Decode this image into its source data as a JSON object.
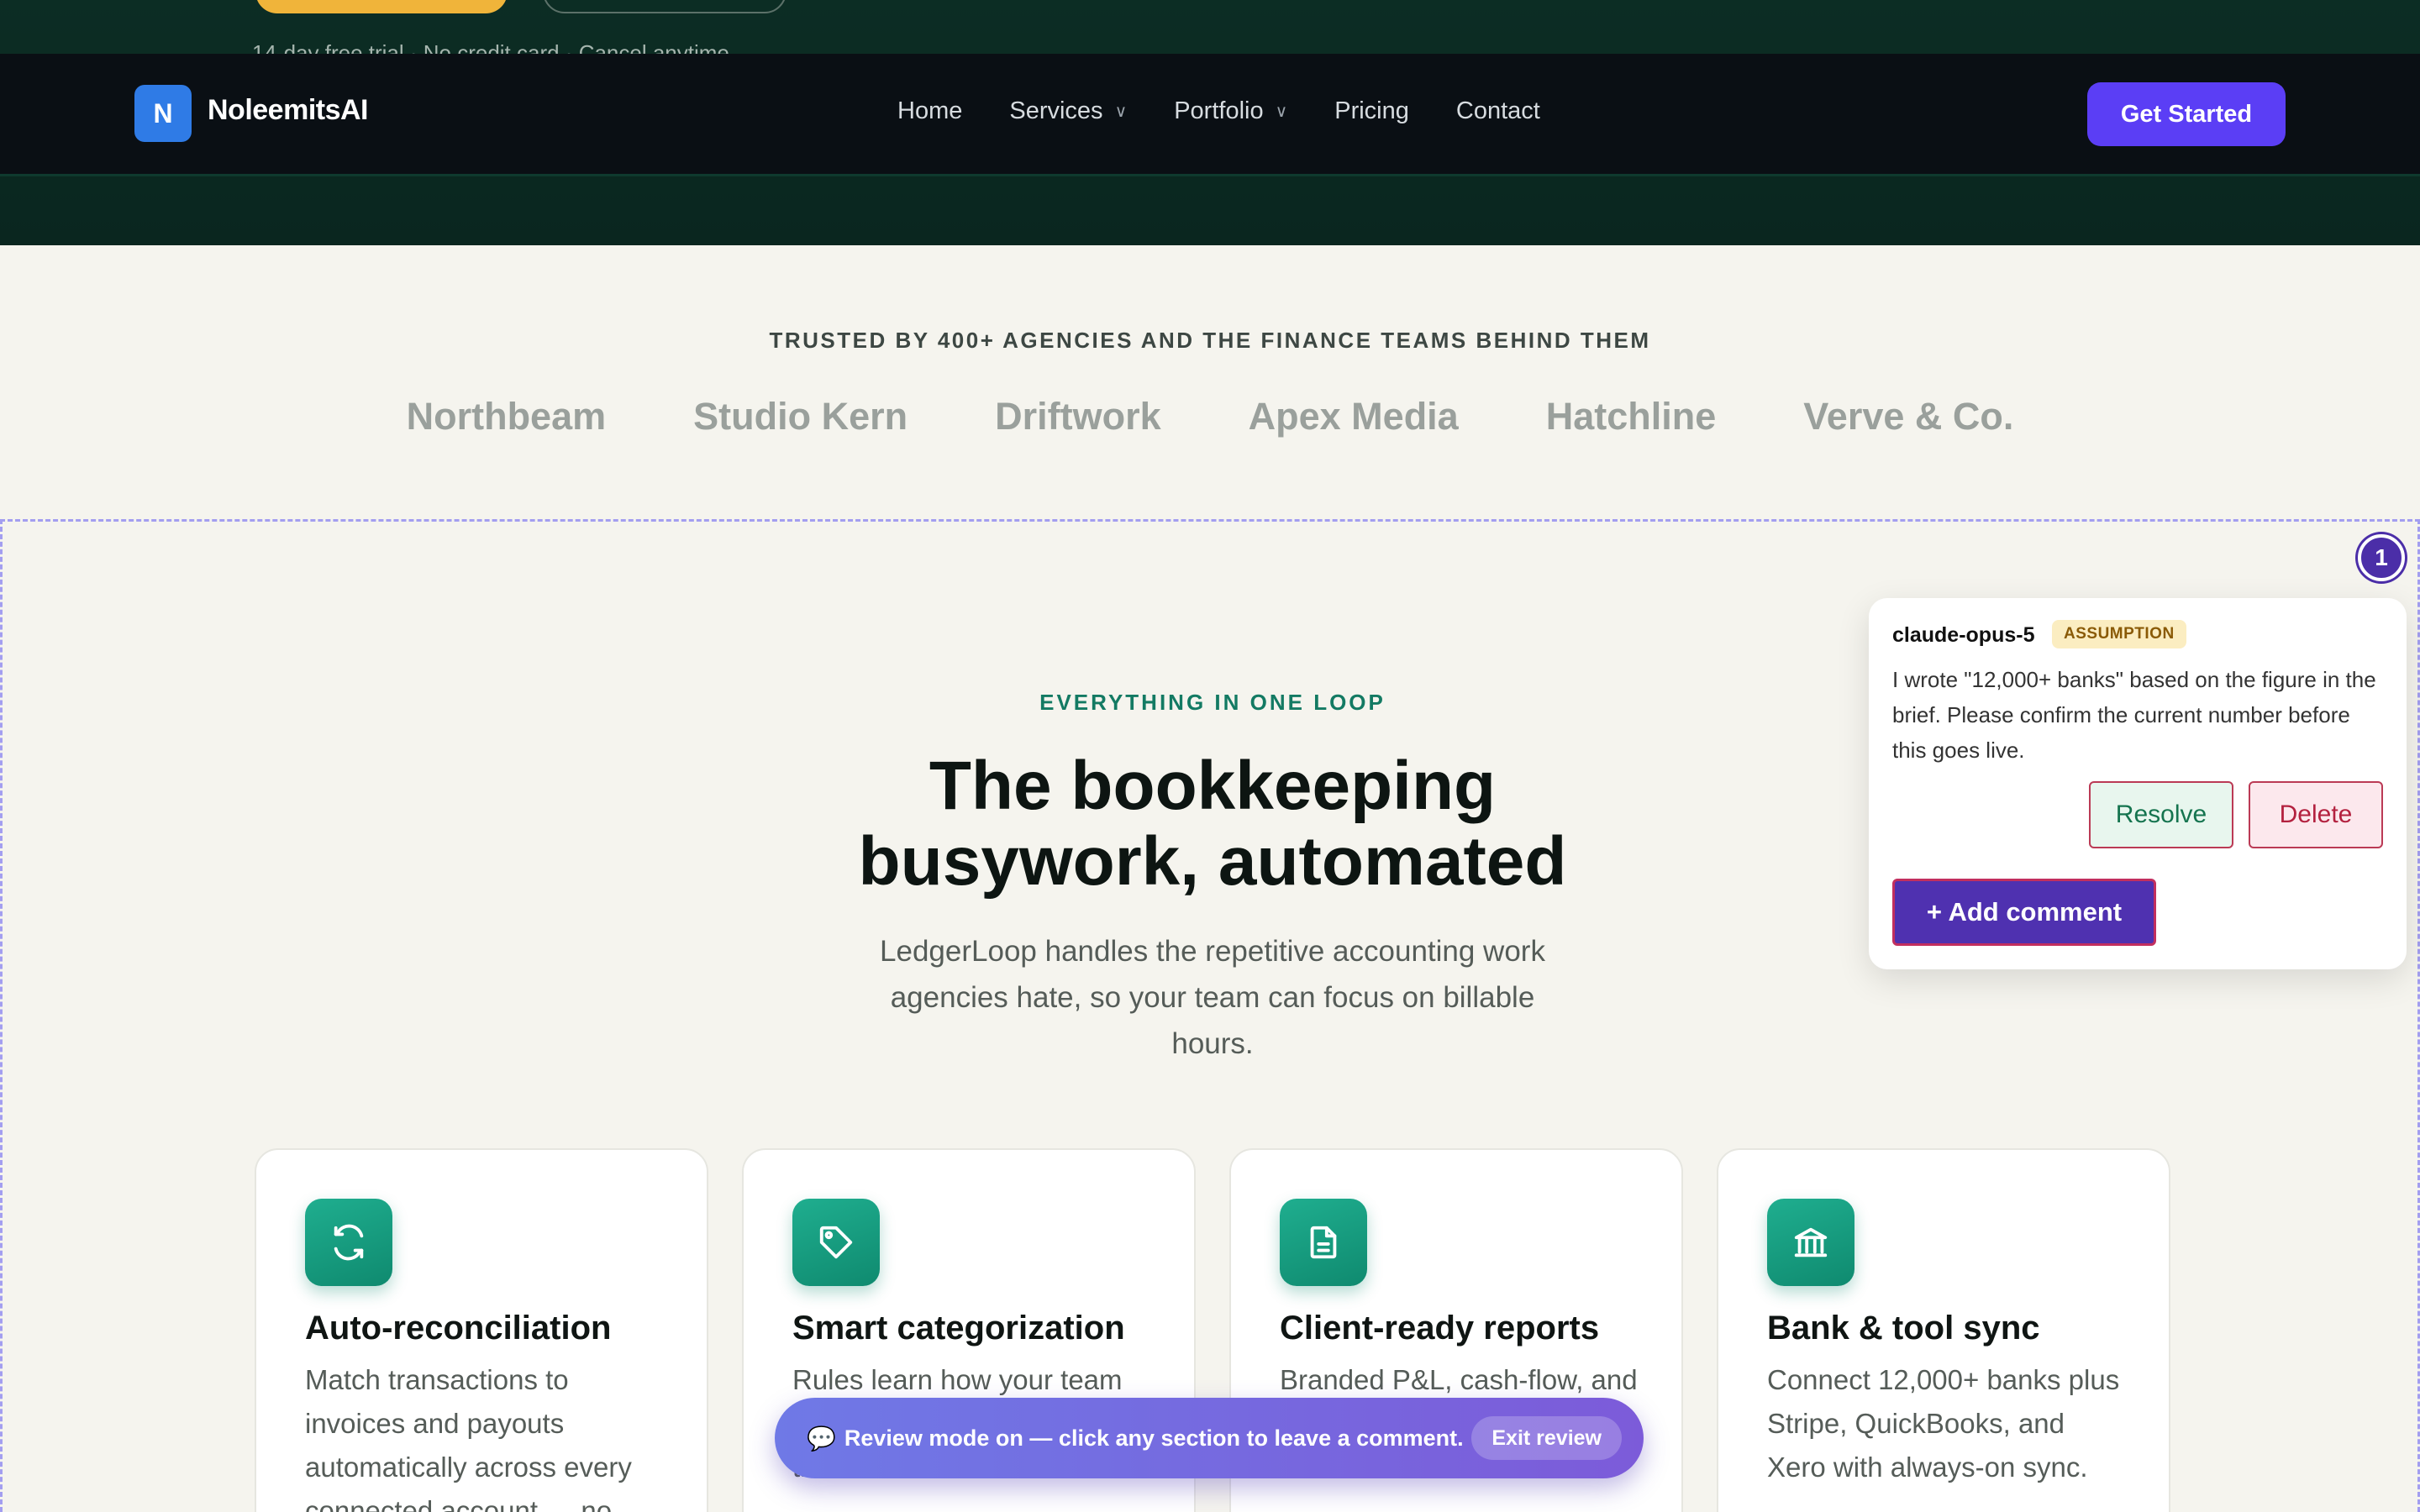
{
  "hero": {
    "note": "14-day free trial · No credit card · Cancel anytime"
  },
  "nav": {
    "logo_letter": "N",
    "brand": "NoleemitsAI",
    "links": [
      {
        "label": "Home",
        "has_dropdown": false
      },
      {
        "label": "Services",
        "has_dropdown": true
      },
      {
        "label": "Portfolio",
        "has_dropdown": true
      },
      {
        "label": "Pricing",
        "has_dropdown": false
      },
      {
        "label": "Contact",
        "has_dropdown": false
      }
    ],
    "cta": "Get Started"
  },
  "trusted": {
    "title": "TRUSTED BY 400+ AGENCIES AND THE FINANCE TEAMS BEHIND THEM",
    "logos": [
      "Northbeam",
      "Studio Kern",
      "Driftwork",
      "Apex Media",
      "Hatchline",
      "Verve & Co."
    ]
  },
  "features": {
    "eyebrow": "EVERYTHING IN ONE LOOP",
    "headline_line1": "The bookkeeping",
    "headline_line2": "busywork, automated",
    "subhead": "LedgerLoop handles the repetitive accounting work agencies hate, so your team can focus on billable hours.",
    "cards": [
      {
        "icon": "refresh-icon",
        "title": "Auto-reconciliation",
        "text": "Match transactions to invoices and payouts automatically across every connected account — no"
      },
      {
        "icon": "tag-icon",
        "title": "Smart categorization",
        "text": "Rules learn how your team codes expenses and apply them the moment data lands"
      },
      {
        "icon": "document-icon",
        "title": "Client-ready reports",
        "text": "Branded P&L, cash-flow, and retainer reports for every client in one click."
      },
      {
        "icon": "bank-icon",
        "title": "Bank & tool sync",
        "text": "Connect 12,000+ banks plus Stripe, QuickBooks, and Xero with always-on sync."
      }
    ]
  },
  "comment": {
    "pin_number": "1",
    "author": "claude-opus-5",
    "tag": "ASSUMPTION",
    "text": "I wrote \"12,000+ banks\" based on the figure in the brief. Please confirm the current number before this goes live.",
    "resolve_label": "Resolve",
    "delete_label": "Delete",
    "add_label": "+ Add comment"
  },
  "review_bar": {
    "icon": "💬",
    "text": "Review mode on — click any section to leave a comment.",
    "exit_label": "Exit review"
  },
  "colors": {
    "nav_bg": "#0a0f14",
    "hero_bg": "#0c2d24",
    "accent_purple": "#5b3ef5",
    "accent_teal": "#137a63",
    "page_bg": "#f5f4ee"
  }
}
